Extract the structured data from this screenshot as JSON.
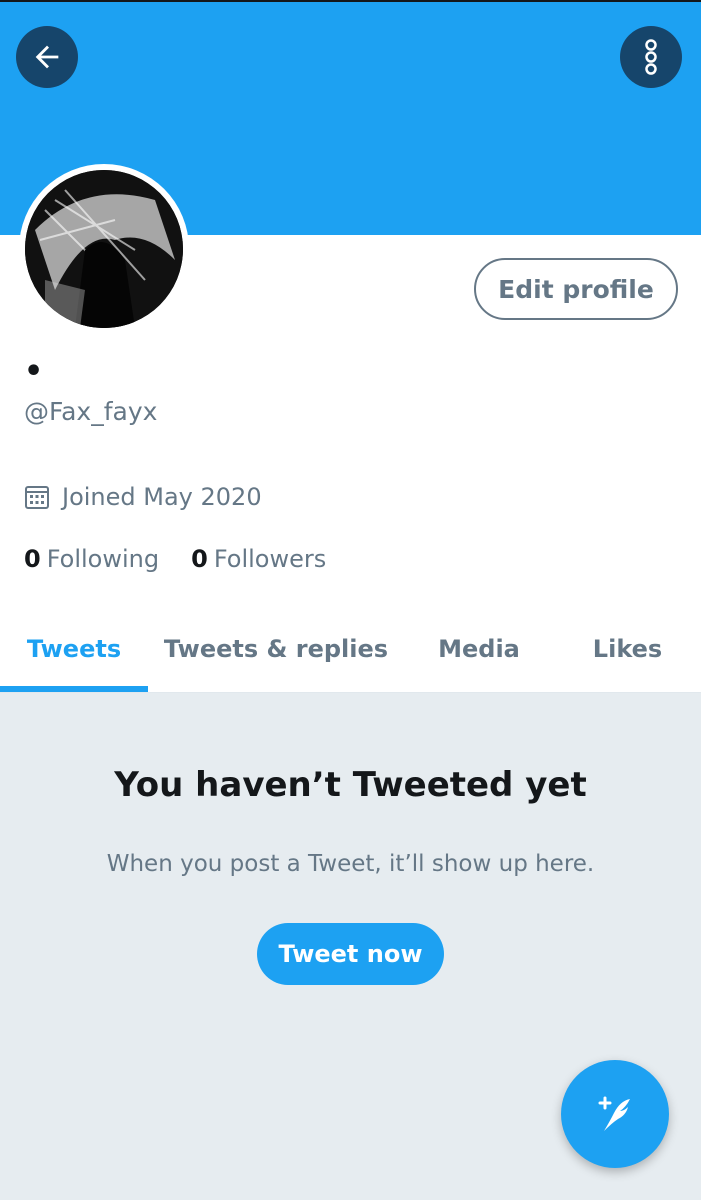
{
  "header": {
    "back_icon": "arrow-left-icon",
    "more_icon": "vertical-ellipsis-icon"
  },
  "profile": {
    "display_name": "•",
    "handle": "@Fax_fayx",
    "joined": "Joined May 2020",
    "edit_label": "Edit profile",
    "following_count": "0",
    "following_label": "Following",
    "followers_count": "0",
    "followers_label": "Followers"
  },
  "tabs": [
    {
      "label": "Tweets",
      "active": true
    },
    {
      "label": "Tweets & replies",
      "active": false
    },
    {
      "label": "Media",
      "active": false
    },
    {
      "label": "Likes",
      "active": false
    }
  ],
  "empty_state": {
    "title": "You haven’t Tweeted yet",
    "subtitle": "When you post a Tweet, it’ll show up here.",
    "button_label": "Tweet now"
  },
  "fab": {
    "icon": "compose-tweet-icon"
  },
  "colors": {
    "accent": "#1da1f2",
    "dark_button": "#16456b",
    "text_primary": "#14171a",
    "text_secondary": "#657786",
    "background": "#e6ecf0"
  }
}
